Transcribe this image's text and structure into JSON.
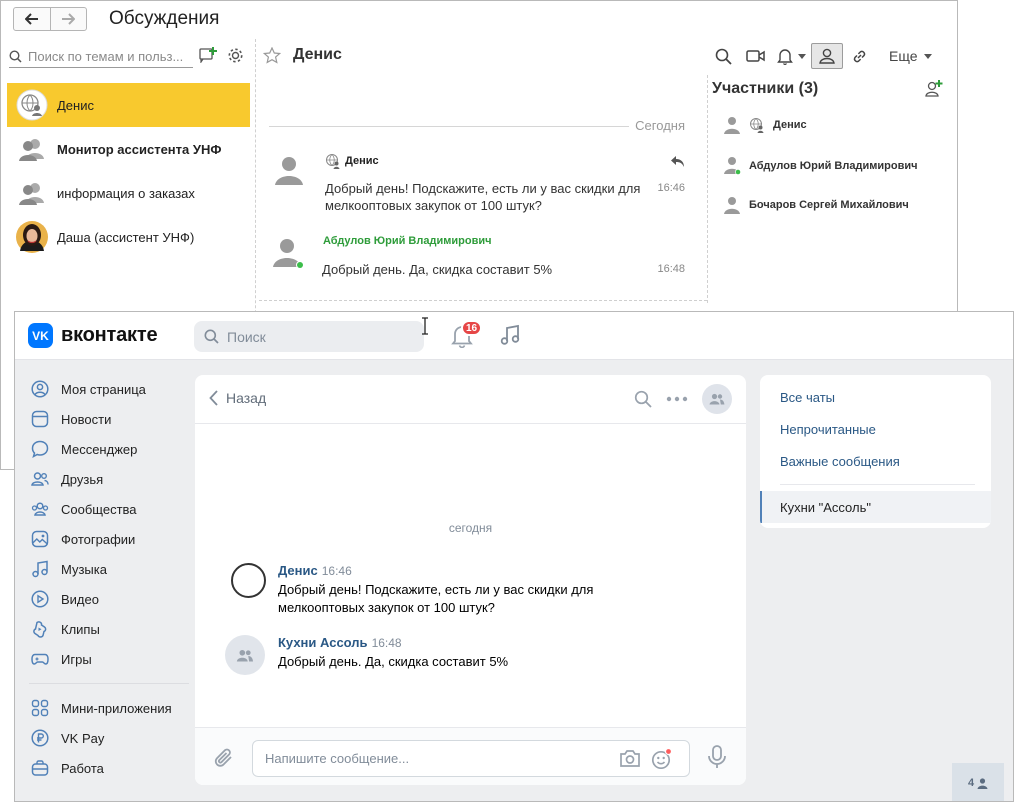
{
  "c1c": {
    "title": "Обсуждения",
    "search_placeholder": "Поиск по темам и польз...",
    "conversations": [
      {
        "label": "Денис",
        "bold": false,
        "active": true
      },
      {
        "label": "Монитор ассистента УНФ",
        "bold": true,
        "active": false
      },
      {
        "label": "информация о заказах",
        "bold": false,
        "active": false
      },
      {
        "label": "Даша (ассистент УНФ)",
        "bold": false,
        "active": false
      }
    ],
    "chat_name": "Денис",
    "more_label": "Еще",
    "today_label": "Сегодня",
    "messages": [
      {
        "author": "Денис",
        "text": "Добрый день! Подскажите, есть ли у вас скидки для мелкооптовых закупок от 100 штук?",
        "time": "16:46",
        "author_color": "#222222"
      },
      {
        "author": "Абдулов Юрий Владимирович",
        "text": "Добрый день. Да, скидка составит 5%",
        "time": "16:48",
        "author_color": "#2e9c3a"
      }
    ],
    "participants_title": "Участники (3)",
    "participants": [
      {
        "name": "Денис",
        "online": false
      },
      {
        "name": "Абдулов Юрий Владимирович",
        "online": true
      },
      {
        "name": "Бочаров Сергей Михайлович",
        "online": false
      }
    ],
    "accent": "#f8c92e"
  },
  "vk": {
    "logo_text": "вконтакте",
    "logo_mark": "VK",
    "search_placeholder": "Поиск",
    "notifications_count": "16",
    "menu": [
      {
        "label": "Моя страница",
        "icon": "user-circle-icon"
      },
      {
        "label": "Новости",
        "icon": "news-icon"
      },
      {
        "label": "Мессенджер",
        "icon": "message-icon"
      },
      {
        "label": "Друзья",
        "icon": "friends-icon"
      },
      {
        "label": "Сообщества",
        "icon": "communities-icon"
      },
      {
        "label": "Фотографии",
        "icon": "photo-icon"
      },
      {
        "label": "Музыка",
        "icon": "music-icon"
      },
      {
        "label": "Видео",
        "icon": "video-icon"
      },
      {
        "label": "Клипы",
        "icon": "clips-icon"
      },
      {
        "label": "Игры",
        "icon": "gamepad-icon"
      }
    ],
    "menu2": [
      {
        "label": "Мини-приложения",
        "icon": "apps-icon"
      },
      {
        "label": "VK Pay",
        "icon": "vkpay-icon"
      },
      {
        "label": "Работа",
        "icon": "briefcase-icon"
      }
    ],
    "back_label": "Назад",
    "date_label": "сегодня",
    "messages": [
      {
        "author": "Денис",
        "time": "16:46",
        "text": "Добрый день! Подскажите, есть ли у вас скидки для мелкооптовых закупок от 100 штук?"
      },
      {
        "author": "Кухни Ассоль",
        "time": "16:48",
        "text": "Добрый день. Да, скидка составит 5%"
      }
    ],
    "compose_placeholder": "Напишите сообщение...",
    "right_menu": [
      "Все чаты",
      "Непрочитанные",
      "Важные сообщения"
    ],
    "right_selected": "Кухни \"Ассоль\"",
    "online_count": "4",
    "accent": "#0077ff"
  }
}
